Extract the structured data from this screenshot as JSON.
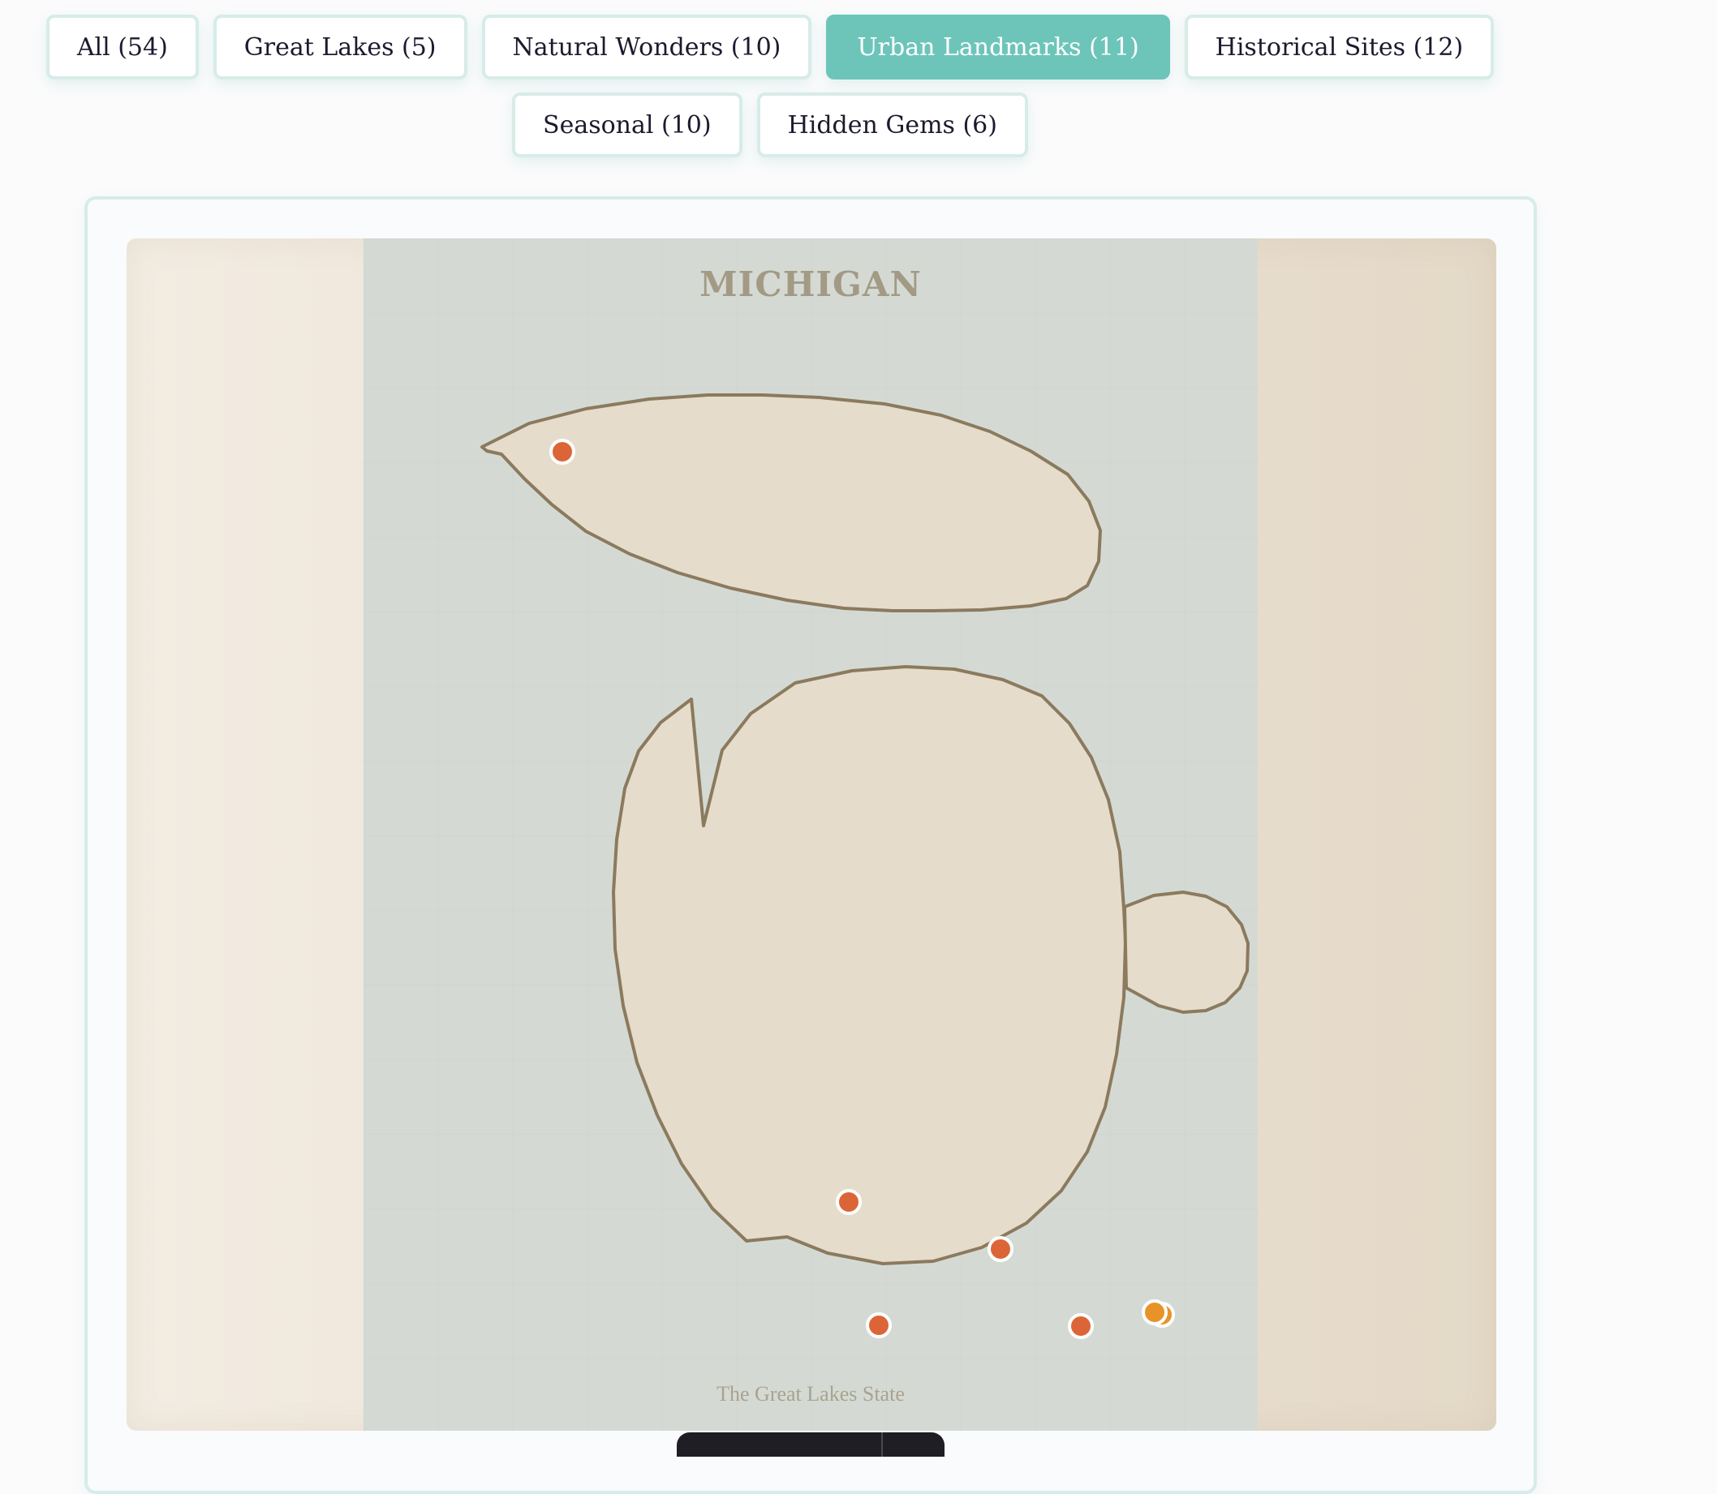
{
  "filters": [
    {
      "label": "All (54)",
      "active": false
    },
    {
      "label": "Great Lakes (5)",
      "active": false
    },
    {
      "label": "Natural Wonders (10)",
      "active": false
    },
    {
      "label": "Urban Landmarks (11)",
      "active": true
    },
    {
      "label": "Historical Sites (12)",
      "active": false
    },
    {
      "label": "Seasonal (10)",
      "active": false
    },
    {
      "label": "Hidden Gems (6)",
      "active": false
    }
  ],
  "map": {
    "title": "MICHIGAN",
    "subtitle": "The Great Lakes State",
    "colors": {
      "land": "#e6dccb",
      "outline": "#8b7a5e",
      "water": "#d4dad3",
      "pin_urban": "#dc6538",
      "pin_seasonal": "#e8922a"
    }
  }
}
